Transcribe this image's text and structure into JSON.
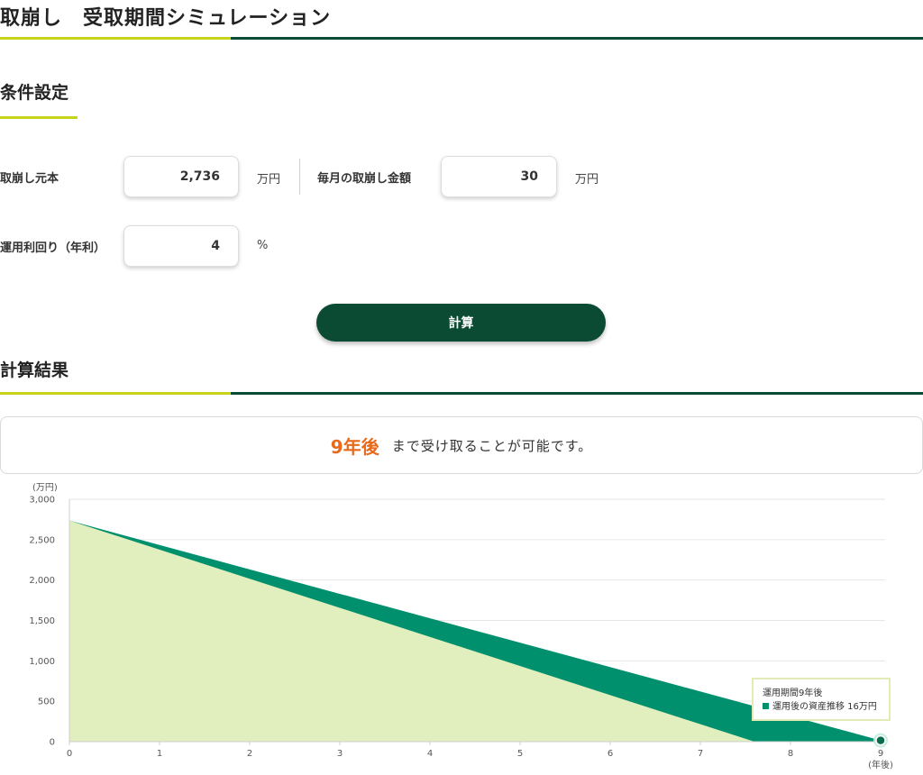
{
  "header": {
    "title": "取崩し　受取期間シミュレーション"
  },
  "conditions": {
    "title": "条件設定",
    "principal": {
      "label": "取崩し元本",
      "value": "2,736",
      "unit": "万円"
    },
    "monthly": {
      "label": "毎月の取崩し金額",
      "value": "30",
      "unit": "万円"
    },
    "rate": {
      "label": "運用利回り（年利）",
      "value": "4",
      "unit": "%"
    },
    "calc_label": "計算"
  },
  "results": {
    "title": "計算結果",
    "years": "9年後",
    "message": "まで受け取ることが可能です。"
  },
  "tooltip": {
    "line1": "運用期間9年後",
    "line2": "運用後の資産推移 16万円"
  },
  "colors": {
    "lime": "#c8d41a",
    "dark": "#0b4a33",
    "accent": "#e8691c",
    "series_invested": "#00906d",
    "series_principal": "#e1eebe"
  },
  "chart_data": {
    "type": "area",
    "y_unit_label": "(万円)",
    "x_unit_label": "(年後)",
    "ylim": [
      0,
      3000
    ],
    "yticks": [
      0,
      500,
      1000,
      1500,
      2000,
      2500,
      3000
    ],
    "ytick_labels": [
      "0",
      "500",
      "1,000",
      "1,500",
      "2,000",
      "2,500",
      "3,000"
    ],
    "xticks": [
      0,
      1,
      2,
      3,
      4,
      5,
      6,
      7,
      8,
      9
    ],
    "xlim": [
      0,
      9
    ],
    "grid": true,
    "series": [
      {
        "name": "運用後の資産推移",
        "x": [
          0,
          9
        ],
        "y": [
          2736,
          16
        ]
      },
      {
        "x": [
          0,
          7.6
        ],
        "y": [
          2736,
          0
        ]
      }
    ]
  }
}
